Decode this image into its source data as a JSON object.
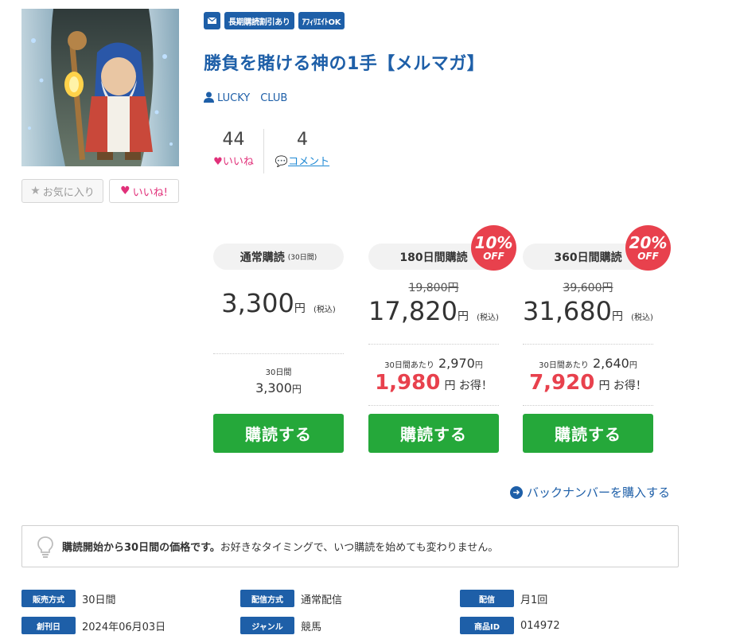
{
  "tags": {
    "mail_icon": "envelope-icon",
    "tag1": "長期購読割引あり",
    "tag2": "ｱﾌｨﾘｴｲﾄOK"
  },
  "title": "勝負を賭ける神の1手【メルマガ】",
  "author": "LUCKY　CLUB",
  "stats": {
    "likes": "44",
    "likes_label": "いいね",
    "comments": "4",
    "comments_label": "コメント"
  },
  "buttons": {
    "favorite": "お気に入り",
    "like": "いいね!"
  },
  "plans": [
    {
      "name": "通常購読",
      "period_note": "(30日間)",
      "strike": "",
      "price": "3,300",
      "yen": "円",
      "tax": "(税込)",
      "detail_small": "30日間",
      "detail_value": "3,300",
      "detail_yen": "円",
      "save_value": "",
      "save_unit": "",
      "badge_pct": "",
      "badge_off": "",
      "buy": "購読する"
    },
    {
      "name": "180日間購読",
      "period_note": "",
      "strike": "19,800円",
      "price": "17,820",
      "yen": "円",
      "tax": "(税込)",
      "detail_small": "30日間あたり",
      "detail_value": "2,970",
      "detail_yen": "円",
      "save_value": "1,980",
      "save_unit": "円 お得！",
      "badge_pct": "10%",
      "badge_off": "OFF",
      "buy": "購読する"
    },
    {
      "name": "360日間購読",
      "period_note": "",
      "strike": "39,600円",
      "price": "31,680",
      "yen": "円",
      "tax": "(税込)",
      "detail_small": "30日間あたり",
      "detail_value": "2,640",
      "detail_yen": "円",
      "save_value": "7,920",
      "save_unit": "円 お得！",
      "badge_pct": "20%",
      "badge_off": "OFF",
      "buy": "購読する"
    }
  ],
  "backnumber": "バックナンバーを購入する",
  "notice": {
    "bold": "購読開始から30日間の価格です。",
    "rest": "お好きなタイミングで、いつ購読を始めても変わりません。"
  },
  "info": [
    {
      "key": "販売方式",
      "value": "30日間"
    },
    {
      "key": "配信方式",
      "value": "通常配信"
    },
    {
      "key": "配信",
      "value": "月1回"
    },
    {
      "key": "創刊日",
      "value": "2024年06月03日"
    },
    {
      "key": "ジャンル",
      "value": "競馬"
    },
    {
      "key": "商品ID",
      "value": "014972"
    }
  ],
  "colors": {
    "brand": "#1e5fa8",
    "buy": "#25a83a",
    "accent": "#e8414d",
    "like": "#e1317a"
  }
}
